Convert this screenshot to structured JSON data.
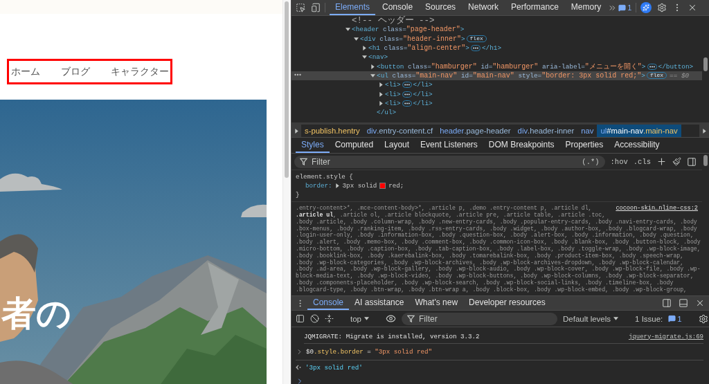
{
  "page": {
    "outlined": true,
    "nav": [
      {
        "label": "ホーム"
      },
      {
        "label": "ブログ"
      },
      {
        "label": "キャラクター"
      }
    ],
    "hero": {
      "kind": "picture",
      "headline": "者の"
    }
  },
  "devtools": {
    "tabs": [
      {
        "label": "Elements",
        "selected": true
      },
      {
        "label": "Console",
        "selected": false
      },
      {
        "label": "Sources",
        "selected": false
      },
      {
        "label": "Network",
        "selected": false
      },
      {
        "label": "Performance",
        "selected": false
      },
      {
        "label": "Memory",
        "selected": false
      }
    ],
    "issues": "1",
    "dom_tree": [
      {
        "tokens": [
          {
            "kind": "comment",
            "text": "<!-- ヘッダー -->"
          }
        ]
      },
      {
        "expanded": true,
        "tokens": [
          {
            "kind": "tag",
            "text": "<header"
          },
          {
            "kind": "attr",
            "text": " class="
          },
          {
            "kind": "value",
            "text": "\"page-header\""
          },
          {
            "kind": "tag",
            "text": ">"
          }
        ],
        "children": [
          {
            "expanded": true,
            "badge": "flex",
            "tokens": [
              {
                "kind": "tag",
                "text": "<div"
              },
              {
                "kind": "attr",
                "text": " class="
              },
              {
                "kind": "value",
                "text": "\"header-inner\""
              },
              {
                "kind": "tag",
                "text": ">"
              }
            ],
            "children": [
              {
                "expanded": false,
                "collapsed_end": "</h1>",
                "tokens": [
                  {
                    "kind": "tag",
                    "text": "<h1"
                  },
                  {
                    "kind": "attr",
                    "text": " class="
                  },
                  {
                    "kind": "value",
                    "text": "\"align-center\""
                  },
                  {
                    "kind": "tag",
                    "text": ">"
                  }
                ]
              },
              {
                "expanded": true,
                "tokens": [
                  {
                    "kind": "tag",
                    "text": "<nav>"
                  }
                ],
                "children": [
                  {
                    "expanded": false,
                    "collapsed_end": "</button>",
                    "tokens": [
                      {
                        "kind": "tag",
                        "text": "<button"
                      },
                      {
                        "kind": "attr",
                        "text": " class="
                      },
                      {
                        "kind": "value",
                        "text": "\"hamburger\""
                      },
                      {
                        "kind": "attr",
                        "text": " id="
                      },
                      {
                        "kind": "value",
                        "text": "\"hamburger\""
                      },
                      {
                        "kind": "attr",
                        "text": " aria-label="
                      },
                      {
                        "kind": "value",
                        "text": "\"メニューを開く\""
                      },
                      {
                        "kind": "tag",
                        "text": ">"
                      }
                    ]
                  },
                  {
                    "expanded": true,
                    "selected": true,
                    "badge": "flex",
                    "marker": "== $0",
                    "closing": "</ul>",
                    "tokens": [
                      {
                        "kind": "tag",
                        "text": "<ul"
                      },
                      {
                        "kind": "attr",
                        "text": " class="
                      },
                      {
                        "kind": "value",
                        "text": "\"main-nav\""
                      },
                      {
                        "kind": "attr",
                        "text": " id="
                      },
                      {
                        "kind": "value",
                        "text": "\"main-nav\""
                      },
                      {
                        "kind": "attr",
                        "text": " style="
                      },
                      {
                        "kind": "value",
                        "text": "\"border: 3px solid red;\""
                      },
                      {
                        "kind": "tag",
                        "text": ">"
                      }
                    ],
                    "children": [
                      {
                        "expanded": false,
                        "collapsed_end": "</li>",
                        "tokens": [
                          {
                            "kind": "tag",
                            "text": "<li>"
                          }
                        ]
                      },
                      {
                        "expanded": false,
                        "collapsed_end": "</li>",
                        "tokens": [
                          {
                            "kind": "tag",
                            "text": "<li>"
                          }
                        ]
                      },
                      {
                        "expanded": false,
                        "collapsed_end": "</li>",
                        "tokens": [
                          {
                            "kind": "tag",
                            "text": "<li>"
                          }
                        ]
                      }
                    ]
                  }
                ]
              }
            ]
          }
        ]
      }
    ],
    "breadcrumbs": [
      {
        "selected": false,
        "parts": [
          {
            "kind": "class",
            "text": "s-publish.hentry"
          }
        ]
      },
      {
        "selected": false,
        "parts": [
          {
            "kind": "tag",
            "text": "div"
          },
          {
            "kind": "tagclass",
            "text": ".entry-content.cf"
          }
        ]
      },
      {
        "selected": false,
        "parts": [
          {
            "kind": "tag",
            "text": "header"
          },
          {
            "kind": "tagclass",
            "text": ".page-header"
          }
        ]
      },
      {
        "selected": false,
        "parts": [
          {
            "kind": "tag",
            "text": "div"
          },
          {
            "kind": "tagclass",
            "text": ".header-inner"
          }
        ]
      },
      {
        "selected": false,
        "parts": [
          {
            "kind": "tag",
            "text": "nav"
          }
        ]
      },
      {
        "selected": true,
        "parts": [
          {
            "kind": "tag",
            "text": "ul"
          },
          {
            "kind": "id",
            "text": "#main-nav"
          },
          {
            "kind": "class",
            "text": ".main-nav"
          }
        ]
      }
    ],
    "style_tabs": [
      {
        "label": "Styles",
        "selected": true
      },
      {
        "label": "Computed",
        "selected": false
      },
      {
        "label": "Layout",
        "selected": false
      },
      {
        "label": "Event Listeners",
        "selected": false
      },
      {
        "label": "DOM Breakpoints",
        "selected": false
      },
      {
        "label": "Properties",
        "selected": false
      },
      {
        "label": "Accessibility",
        "selected": false
      }
    ],
    "styles_filter": {
      "placeholder": "Filter"
    },
    "style_tools": [
      "(.*)",
      ":hov",
      ".cls"
    ],
    "rules": [
      {
        "kind": "inline",
        "selector": "element.style {",
        "close": "}",
        "declarations": [
          {
            "property": "border:",
            "value": "3px solid",
            "color": "#ff0000",
            "color_name": "red;"
          }
        ]
      },
      {
        "kind": "stylesheet",
        "source": "cocoon-skin…nline-css:2",
        "selector_lines": [
          ".entry-content>*, .mce-content-body>*, .article p, .demo .entry-content p, .article dl,",
          {
            "markup": "**.article ul**, .article ol, .article blockquote, .article pre, .article table, .article .toc,"
          },
          ".body .article, .body .column-wrap, .body .new-entry-cards, .body .popular-entry-cards, .body .navi-entry-cards, .body",
          ".box-menus, .body .ranking-item, .body .rss-entry-cards, .body .widget, .body .author-box, .body .blogcard-wrap, .body",
          ".login-user-only, .body .information-box, .body .question-box, .body .alert-box, .body .information, .body .question,",
          ".body .alert, .body .memo-box, .body .comment-box, .body .common-icon-box, .body .blank-box, .body .button-block, .body",
          ".micro-bottom, .body .caption-box, .body .tab-caption-box, .body .label-box, .body .toggle-wrap, .body .wp-block-image,",
          ".body .booklink-box, .body .kaerebalink-box, .body .tomarebalink-box, .body .product-item-box, .body .speech-wrap,",
          ".body .wp-block-categories, .body .wp-block-archives, .body .wp-block-archives-dropdown, .body .wp-block-calendar,",
          ".body .ad-area, .body .wp-block-gallery, .body .wp-block-audio, .body .wp-block-cover, .body .wp-block-file, .body .wp-",
          "block-media-text, .body .wp-block-video, .body .wp-block-buttons, .body .wp-block-columns, .body .wp-block-separator,",
          ".body .components-placeholder, .body .wp-block-search, .body .wp-block-social-links, .body .timeline-box, .body",
          ".blogcard-type, .body .btn-wrap, .body .btn-wrap a, .body .block-box, .body .wp-block-embed, .body .wp-block-group,"
        ]
      }
    ],
    "drawer_tabs": [
      {
        "label": "Console",
        "selected": true
      },
      {
        "label": "AI assistance",
        "selected": false
      },
      {
        "label": "What's new",
        "selected": false
      },
      {
        "label": "Developer resources",
        "selected": false
      }
    ],
    "console": {
      "context": "top",
      "filter": {
        "placeholder": "Filter"
      },
      "levels": "Default levels",
      "issues_label": "1 Issue:",
      "issues_count": "1",
      "messages": [
        {
          "kind": "log",
          "text": "JQMIGRATE: Migrate is installed, version 3.3.2",
          "source": "jquery-migrate.js:69"
        },
        {
          "kind": "input",
          "tokens": [
            {
              "kind": "plain",
              "text": "$0"
            },
            {
              "kind": "prop",
              "text": ".style.border"
            },
            {
              "kind": "plain",
              "text": " = "
            },
            {
              "kind": "string",
              "text": "\"3px solid red\""
            }
          ]
        },
        {
          "kind": "result",
          "text": "'3px solid red'"
        },
        {
          "kind": "prompt"
        }
      ]
    }
  }
}
